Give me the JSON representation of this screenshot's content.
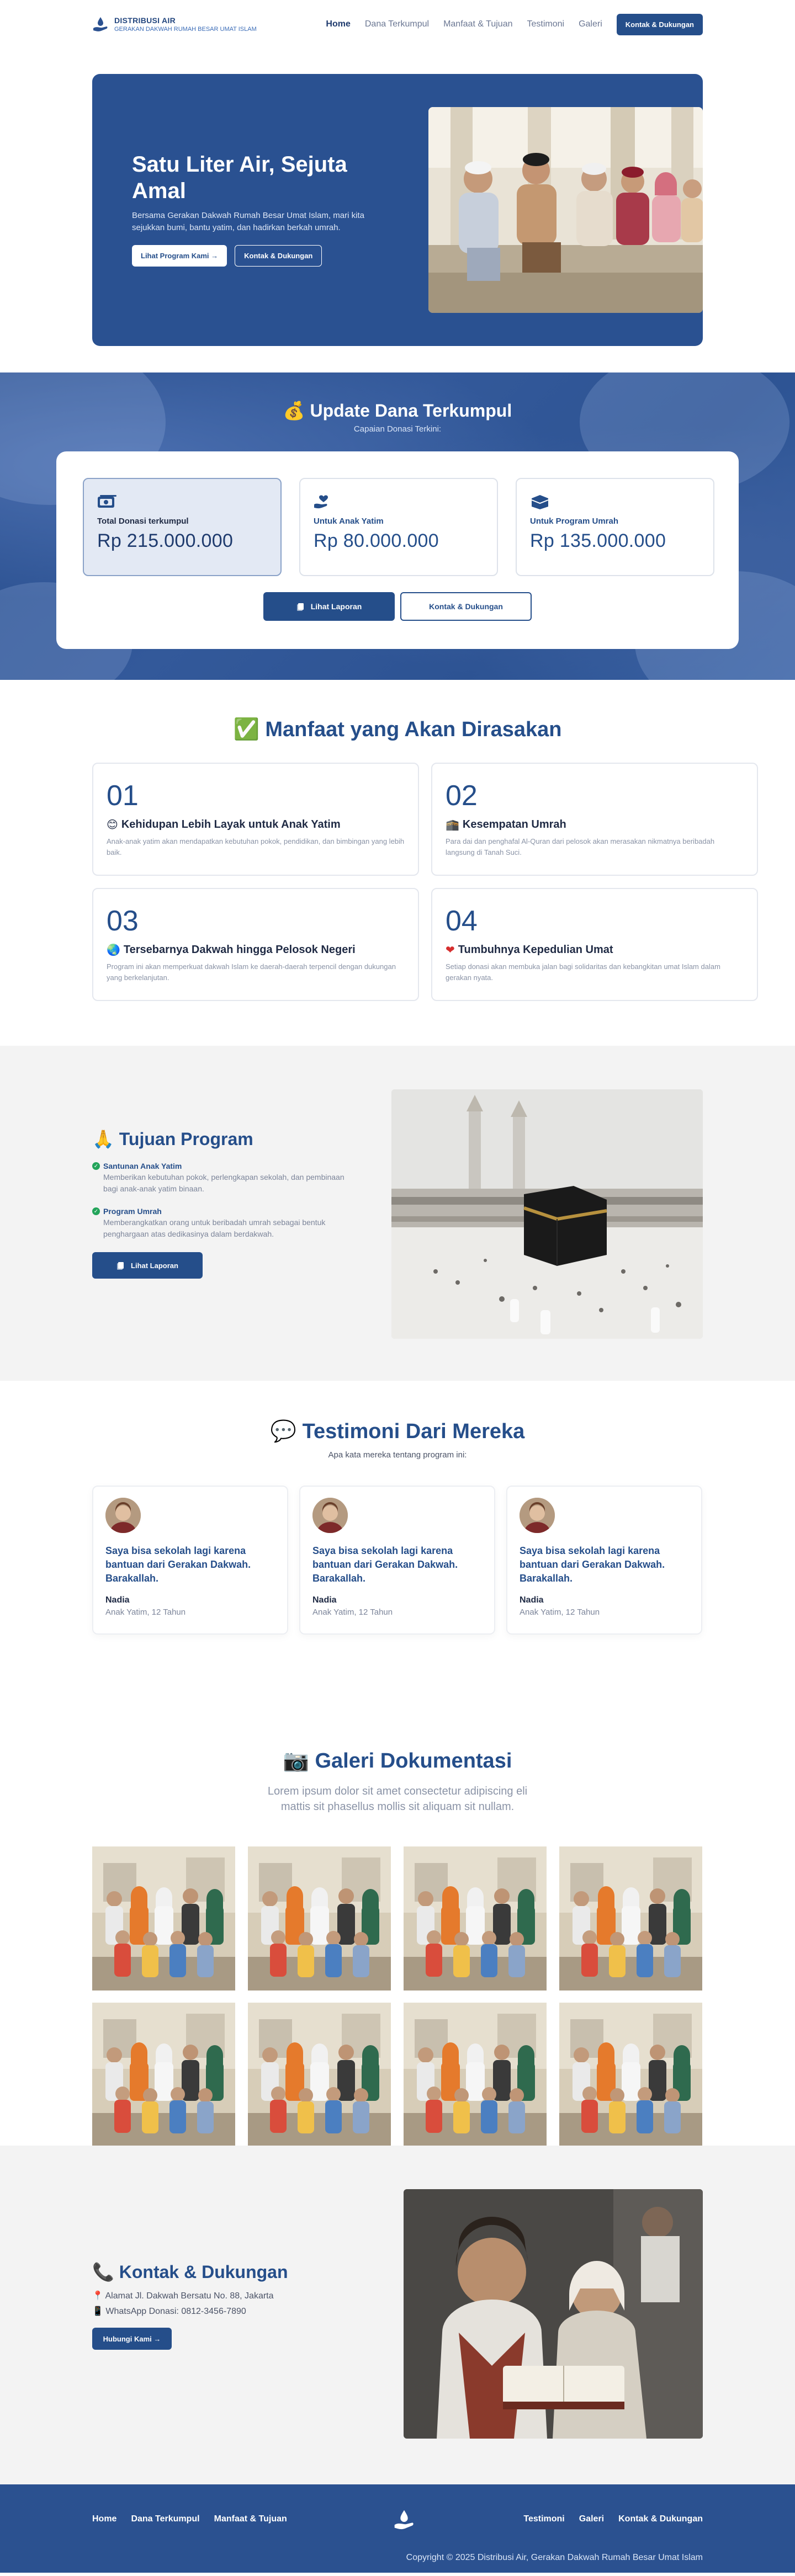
{
  "nav": {
    "brand_title": "DISTRIBUSI AIR",
    "brand_sub": "GERAKAN DAKWAH RUMAH BESAR UMAT ISLAM",
    "links": [
      "Home",
      "Dana Terkumpul",
      "Manfaat & Tujuan",
      "Testimoni",
      "Galeri"
    ],
    "cta": "Kontak & Dukungan"
  },
  "hero": {
    "title": "Satu Liter Air, Sejuta Amal",
    "desc": "Bersama Gerakan Dakwah Rumah Besar Umat Islam, mari kita sejukkan bumi, bantu yatim, dan hadirkan berkah umrah.",
    "btn_program": "Lihat Program Kami →",
    "btn_contact": "Kontak & Dukungan"
  },
  "donasi": {
    "title": "💰 Update Dana Terkumpul",
    "subtitle": "Capaian Donasi Terkini:",
    "stats": [
      {
        "label": "Total Donasi terkumpul",
        "value": "Rp 215.000.000",
        "icon": "money-icon"
      },
      {
        "label": "Untuk Anak Yatim",
        "value": "Rp 80.000.000",
        "icon": "hand-heart-icon"
      },
      {
        "label": "Untuk Program Umrah",
        "value": "Rp 135.000.000",
        "icon": "kaaba-icon"
      }
    ],
    "btn_report": "Lihat Laporan",
    "btn_contact": "Kontak & Dukungan"
  },
  "manfaat": {
    "title": "✅ Manfaat yang Akan Dirasakan",
    "items": [
      {
        "num": "01",
        "emoji": "😊",
        "head": "Kehidupan Lebih Layak untuk Anak Yatim",
        "desc": "Anak-anak yatim akan mendapatkan kebutuhan pokok, pendidikan, dan bimbingan yang lebih baik."
      },
      {
        "num": "02",
        "emoji": "🕋",
        "head": "Kesempatan Umrah",
        "desc": "Para dai dan penghafal Al-Quran dari pelosok akan merasakan nikmatnya beribadah langsung di Tanah Suci."
      },
      {
        "num": "03",
        "emoji": "🌏",
        "head": "Tersebarnya Dakwah hingga Pelosok Negeri",
        "desc": "Program ini akan memperkuat dakwah Islam ke daerah-daerah terpencil dengan dukungan yang berkelanjutan."
      },
      {
        "num": "04",
        "emoji": "❤",
        "head": "Tumbuhnya Kepedulian Umat",
        "desc": "Setiap donasi akan membuka jalan bagi solidaritas dan kebangkitan umat Islam dalam gerakan nyata."
      }
    ]
  },
  "tujuan": {
    "title": "🙏 Tujuan Program",
    "items": [
      {
        "head": "Santunan Anak Yatim",
        "desc": "Memberikan kebutuhan pokok, perlengkapan sekolah, dan pembinaan bagi anak-anak yatim binaan."
      },
      {
        "head": "Program Umrah",
        "desc": "Memberangkatkan orang untuk beribadah umrah sebagai bentuk penghargaan atas dedikasinya dalam berdakwah."
      }
    ],
    "btn": "Lihat Laporan"
  },
  "testimoni": {
    "title": "💬 Testimoni Dari Mereka",
    "subtitle": "Apa kata mereka tentang program ini:",
    "items": [
      {
        "quote": "Saya bisa sekolah lagi karena bantuan dari Gerakan Dakwah. Barakallah.",
        "name": "Nadia",
        "role": "Anak Yatim, 12 Tahun"
      },
      {
        "quote": "Saya bisa sekolah lagi karena bantuan dari Gerakan Dakwah. Barakallah.",
        "name": "Nadia",
        "role": "Anak Yatim, 12 Tahun"
      },
      {
        "quote": "Saya bisa sekolah lagi karena bantuan dari Gerakan Dakwah. Barakallah.",
        "name": "Nadia",
        "role": "Anak Yatim, 12 Tahun"
      }
    ]
  },
  "galeri": {
    "title": "📷 Galeri Dokumentasi",
    "subtitle": "Lorem ipsum dolor sit amet consectetur adipiscing eli mattis sit phasellus mollis sit aliquam sit nullam."
  },
  "kontak": {
    "title": "📞 Kontak & Dukungan",
    "address": "📍 Alamat Jl. Dakwah Bersatu No. 88, Jakarta",
    "whatsapp": "📱 WhatsApp Donasi: 0812-3456-7890",
    "btn": "Hubungi Kami →"
  },
  "footer": {
    "links_left": [
      "Home",
      "Dana Terkumpul",
      "Manfaat & Tujuan"
    ],
    "links_right": [
      "Testimoni",
      "Galeri",
      "Kontak & Dukungan"
    ],
    "copyright": "Copyright © 2025 Distribusi Air, Gerakan Dakwah Rumah Besar Umat Islam"
  },
  "colors": {
    "primary": "#254e8a",
    "accent_green": "#23a45a",
    "muted": "#8a93a6"
  }
}
